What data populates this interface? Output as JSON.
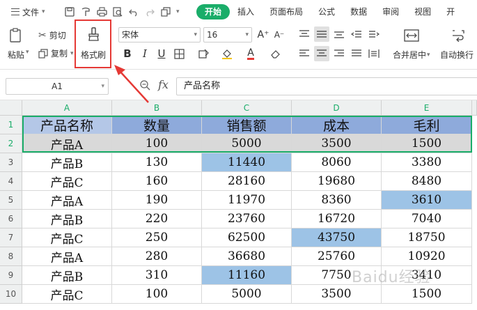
{
  "menubar": {
    "file_label": "文件",
    "quick_icons": [
      "save-icon",
      "format-painter-small-icon",
      "print-icon",
      "print-preview-icon",
      "undo-icon",
      "redo-icon",
      "copy-window-icon"
    ],
    "tabs": [
      {
        "label": "开始",
        "active": true
      },
      {
        "label": "插入",
        "active": false
      },
      {
        "label": "页面布局",
        "active": false
      },
      {
        "label": "公式",
        "active": false
      },
      {
        "label": "数据",
        "active": false
      },
      {
        "label": "审阅",
        "active": false
      },
      {
        "label": "视图",
        "active": false
      },
      {
        "label": "开",
        "active": false
      }
    ]
  },
  "ribbon": {
    "paste_label": "粘贴",
    "cut_label": "剪切",
    "copy_label": "复制",
    "format_painter_label": "格式刷",
    "font_name": "宋体",
    "font_size": "16",
    "merge_label": "合并居中",
    "wrap_label": "自动换行",
    "highlight_color": "#e53935"
  },
  "formula_bar": {
    "cell_ref": "A1",
    "fx_label": "fx",
    "content": "产品名称"
  },
  "sheet": {
    "columns": [
      "A",
      "B",
      "C",
      "D",
      "E"
    ],
    "row_numbers": [
      "1",
      "2",
      "3",
      "4",
      "5",
      "6",
      "7",
      "8",
      "9",
      "10"
    ],
    "header": [
      "产品名称",
      "数量",
      "销售额",
      "成本",
      "毛利"
    ],
    "rows": [
      [
        "产品A",
        "100",
        "5000",
        "3500",
        "1500"
      ],
      [
        "产品B",
        "130",
        "11440",
        "8060",
        "3380"
      ],
      [
        "产品C",
        "160",
        "28160",
        "19680",
        "8480"
      ],
      [
        "产品A",
        "190",
        "11970",
        "8360",
        "3610"
      ],
      [
        "产品B",
        "220",
        "23760",
        "16720",
        "7040"
      ],
      [
        "产品C",
        "250",
        "62500",
        "43750",
        "18750"
      ],
      [
        "产品A",
        "280",
        "36680",
        "25760",
        "10920"
      ],
      [
        "产品B",
        "310",
        "11160",
        "7750",
        "3410"
      ],
      [
        "产品C",
        "100",
        "5000",
        "3500",
        "1500"
      ]
    ],
    "colors": {
      "header_fill_a": "#b4c7e7",
      "header_fill": "#8eaadb",
      "row2_fill": "#d9d9d9",
      "highlight_fill": "#9dc3e6",
      "accent": "#1aad69"
    },
    "highlighted_cells": [
      {
        "row": 2,
        "col": 2
      },
      {
        "row": 4,
        "col": 4
      },
      {
        "row": 6,
        "col": 3
      },
      {
        "row": 8,
        "col": 2
      }
    ]
  },
  "watermark": "Baidu经验"
}
